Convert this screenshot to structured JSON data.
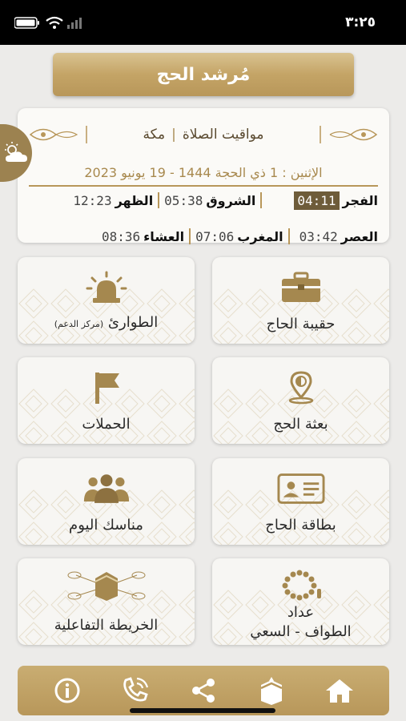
{
  "status_bar": {
    "time": "٣:٢٥"
  },
  "header": {
    "title": "مُرشد الحج"
  },
  "prayer_card": {
    "heading": "مواقيت الصلاة",
    "city": "مكة",
    "date_line": "الإثنين : 1 ذي الحجة 1444 - 19 يونيو 2023",
    "times": [
      {
        "name": "الفجر",
        "time": "04:11",
        "highlight": true
      },
      {
        "name": "الشروق",
        "time": "05:38"
      },
      {
        "name": "الظهر",
        "time": "12:23"
      },
      {
        "name": "العصر",
        "time": "03:42"
      },
      {
        "name": "المغرب",
        "time": "07:06"
      },
      {
        "name": "العشاء",
        "time": "08:36"
      }
    ]
  },
  "tiles": {
    "bag": {
      "label": "حقيبة الحاج",
      "icon": "briefcase-icon"
    },
    "emergency": {
      "label": "الطوارئ",
      "sub": "(مركز الدعم)",
      "icon": "siren-icon"
    },
    "mission": {
      "label": "بعثة الحج",
      "icon": "location-pin-icon"
    },
    "campaigns": {
      "label": "الحملات",
      "icon": "flag-icon"
    },
    "card": {
      "label": "بطاقة الحاج",
      "icon": "id-card-icon"
    },
    "rituals": {
      "label": "مناسك اليوم",
      "icon": "group-icon"
    },
    "counter": {
      "label1": "عداد",
      "label2": "الطواف - السعي",
      "icon": "prayer-beads-icon"
    },
    "map": {
      "label": "الخريطة التفاعلية",
      "icon": "kaaba-map-icon"
    }
  },
  "colors": {
    "gold": "#b8975a",
    "dark_gold": "#6e5c3a"
  }
}
